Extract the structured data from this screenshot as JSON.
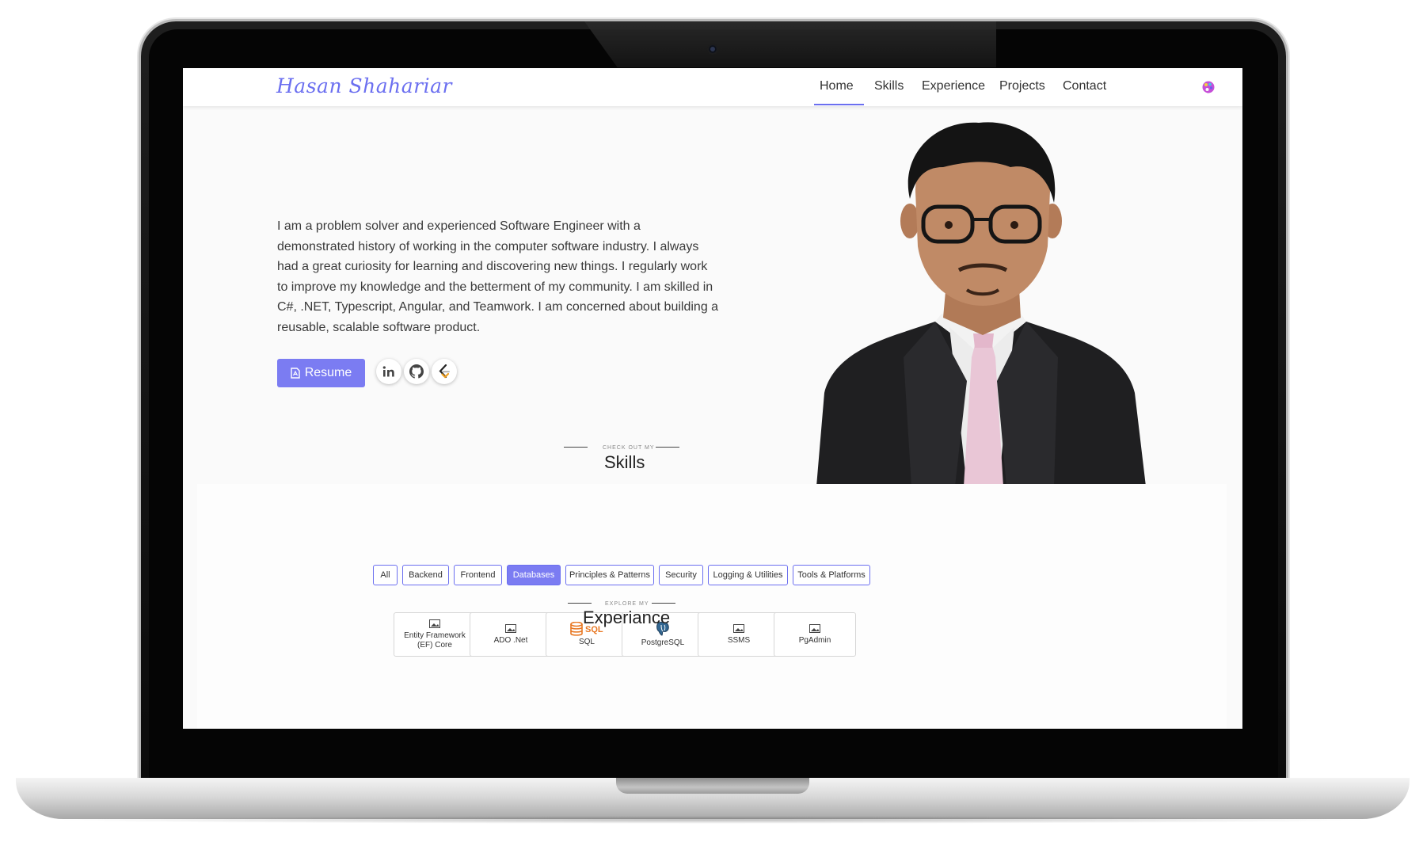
{
  "brand": "Hasan Shahariar",
  "nav": {
    "items": [
      "Home",
      "Skills",
      "Experience",
      "Projects",
      "Contact"
    ],
    "active": "Home"
  },
  "hero": {
    "bio": "I am a problem solver and experienced Software Engineer with a demonstrated history of working in the computer software industry. I always had a great curiosity for learning and discovering new things. I regularly work to improve my knowledge and the betterment of my community. I am skilled in C#, .NET, Typescript, Angular, and Teamwork. I am concerned about building a reusable, scalable software product.",
    "resume_label": "Resume",
    "social_icons": [
      "linkedin-icon",
      "github-icon",
      "leetcode-icon"
    ]
  },
  "skills": {
    "kicker": "CHECK OUT MY",
    "title": "Skills",
    "filters": [
      "All",
      "Backend",
      "Frontend",
      "Databases",
      "Principles & Patterns",
      "Security",
      "Logging & Utilities",
      "Tools & Platforms"
    ],
    "active_filter": "Databases",
    "items": [
      {
        "name": "Entity Framework (EF) Core",
        "icon": "image-placeholder-icon"
      },
      {
        "name": "ADO .Net",
        "icon": "image-placeholder-icon"
      },
      {
        "name": "SQL",
        "icon": "sql-database-icon"
      },
      {
        "name": "PostgreSQL",
        "icon": "postgresql-elephant-icon"
      },
      {
        "name": "SSMS",
        "icon": "image-placeholder-icon"
      },
      {
        "name": "PgAdmin",
        "icon": "image-placeholder-icon"
      }
    ]
  },
  "experience": {
    "kicker": "EXPLORE MY",
    "title": "Experiance"
  },
  "colors": {
    "accent": "#7b7cf2",
    "text": "#3a3a3a",
    "sql_orange": "#e87722"
  }
}
